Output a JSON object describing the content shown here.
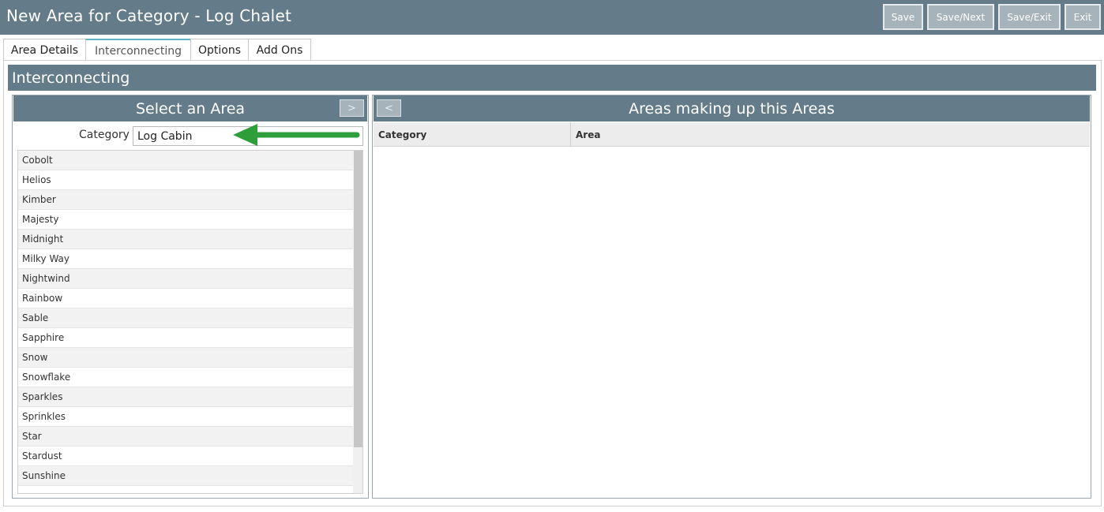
{
  "header": {
    "title": "New Area for Category - Log Chalet",
    "buttons": {
      "save": "Save",
      "save_next": "Save/Next",
      "save_exit": "Save/Exit",
      "exit": "Exit"
    }
  },
  "tabs": {
    "area_details": "Area Details",
    "interconnecting": "Interconnecting",
    "options": "Options",
    "add_ons": "Add Ons",
    "active": "Interconnecting"
  },
  "section": {
    "title": "Interconnecting"
  },
  "left_panel": {
    "title": "Select an Area",
    "move_right_icon": ">",
    "category_label": "Category",
    "category_value": "Log Cabin",
    "areas": [
      "Cobolt",
      "Helios",
      "Kimber",
      "Majesty",
      "Midnight",
      "Milky Way",
      "Nightwind",
      "Rainbow",
      "Sable",
      "Sapphire",
      "Snow",
      "Snowflake",
      "Sparkles",
      "Sprinkles",
      "Star",
      "Stardust",
      "Sunshine"
    ]
  },
  "right_panel": {
    "title": "Areas making up this Areas",
    "move_left_icon": "<",
    "columns": {
      "category": "Category",
      "area": "Area"
    }
  },
  "colors": {
    "header_bg": "#647b89",
    "button_bg": "#a7b3bb",
    "arrow_green": "#2e9e3a",
    "active_tab_accent": "#5fb3c4"
  },
  "icons": {
    "annotation": "green-arrow-icon"
  }
}
